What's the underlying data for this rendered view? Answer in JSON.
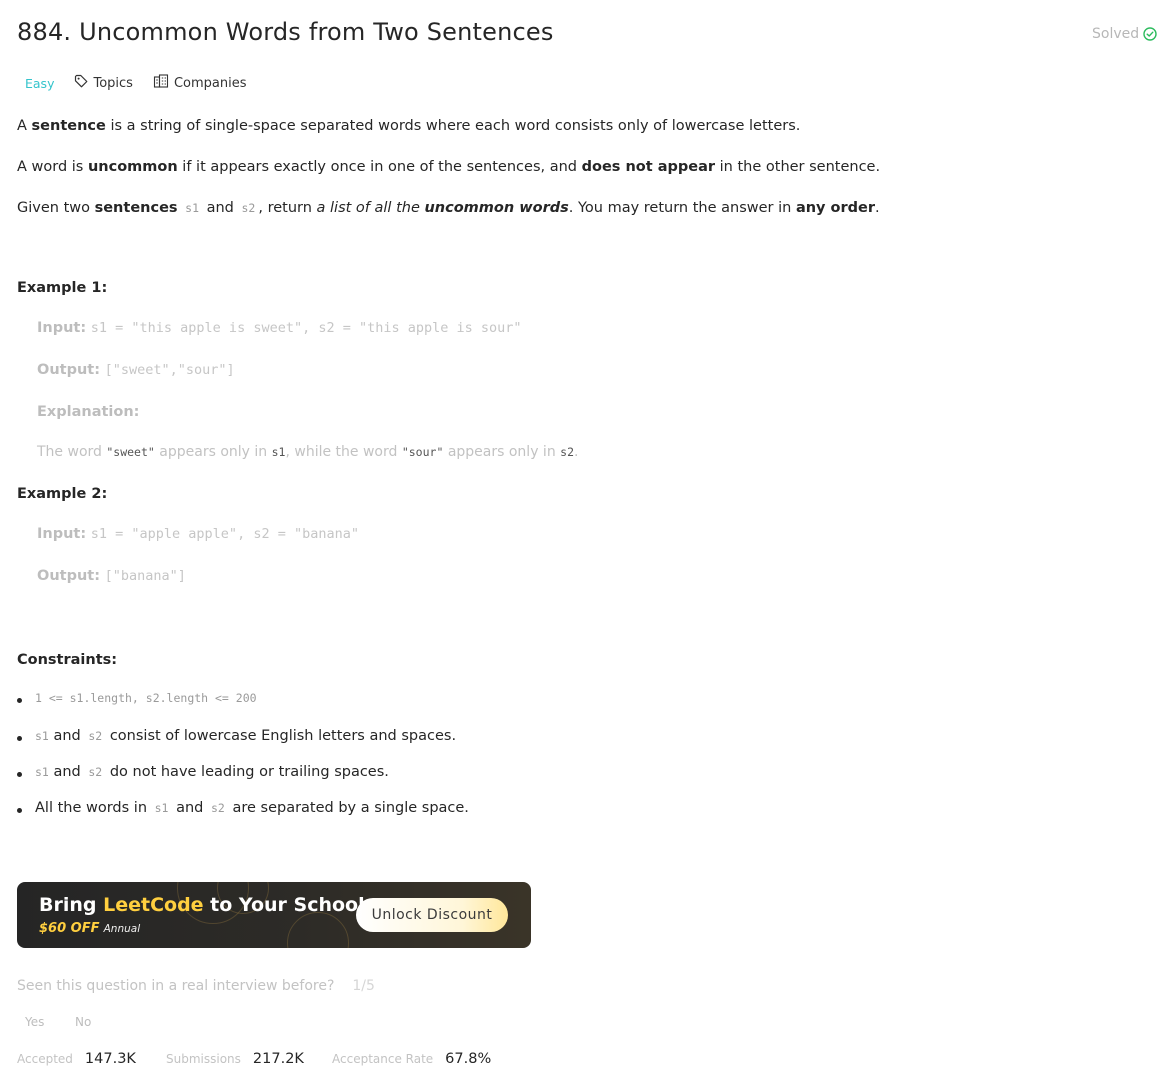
{
  "problem": {
    "title": "884. Uncommon Words from Two Sentences",
    "status": "Solved",
    "difficulty": "Easy",
    "topics_label": "Topics",
    "companies_label": "Companies"
  },
  "description": {
    "p1": {
      "a": "A ",
      "b": "sentence",
      "c": " is a string of single-space separated words where each word consists only of lowercase letters."
    },
    "p2": {
      "a": "A word is ",
      "b": "uncommon",
      "c": " if it appears exactly once in one of the sentences, and ",
      "d": "does not appear",
      "e": " in the other sentence."
    },
    "p3": {
      "a": "Given two ",
      "b": "sentences",
      "c1": "s1",
      "and": "and",
      "c2": "s2",
      "d": ", return ",
      "e": "a list of all the ",
      "f": "uncommon words",
      "g": ". You may return the answer in ",
      "h": "any order",
      "i": "."
    }
  },
  "examples": [
    {
      "heading": "Example 1:",
      "input_label": "Input:",
      "input_value": "s1 = \"this apple is sweet\", s2 = \"this apple is sour\"",
      "output_label": "Output:",
      "output_value": "[\"sweet\",\"sour\"]",
      "explanation_label": "Explanation:",
      "explanation": {
        "a": "The word ",
        "b": "\"sweet\"",
        "c": " appears only in ",
        "d": "s1",
        "e": ", while the word ",
        "f": "\"sour\"",
        "g": " appears only in ",
        "h": "s2",
        "i": "."
      }
    },
    {
      "heading": "Example 2:",
      "input_label": "Input:",
      "input_value": "s1 = \"apple apple\", s2 = \"banana\"",
      "output_label": "Output:",
      "output_value": "[\"banana\"]"
    }
  ],
  "constraints": {
    "heading": "Constraints:",
    "c1": "1 <= s1.length, s2.length <= 200",
    "c2": {
      "a": "s1",
      "b": " and ",
      "c": "s2",
      "d": " consist of lowercase English letters and spaces."
    },
    "c3": {
      "a": "s1",
      "b": " and ",
      "c": "s2",
      "d": " do not have leading or trailing spaces."
    },
    "c4": {
      "a": "All the words in ",
      "b": "s1",
      "c": " and ",
      "d": "s2",
      "e": " are separated by a single space."
    }
  },
  "banner": {
    "bring": "Bring ",
    "leetcode": "LeetCode",
    "rest": " to Your School",
    "off": "$60 OFF",
    "annual": "Annual",
    "button": "Unlock Discount"
  },
  "interview": {
    "question": "Seen this question in a real interview before?",
    "fraction": "1/5",
    "yes": "Yes",
    "no": "No"
  },
  "stats": {
    "accepted_label": "Accepted",
    "accepted_value": "147.3K",
    "submissions_label": "Submissions",
    "submissions_value": "217.2K",
    "rate_label": "Acceptance Rate",
    "rate_value": "67.8%"
  },
  "colors": {
    "easy": "#35c4cc",
    "solved_check": "#2cbb5d",
    "banner_accent": "#ffcf3f"
  }
}
